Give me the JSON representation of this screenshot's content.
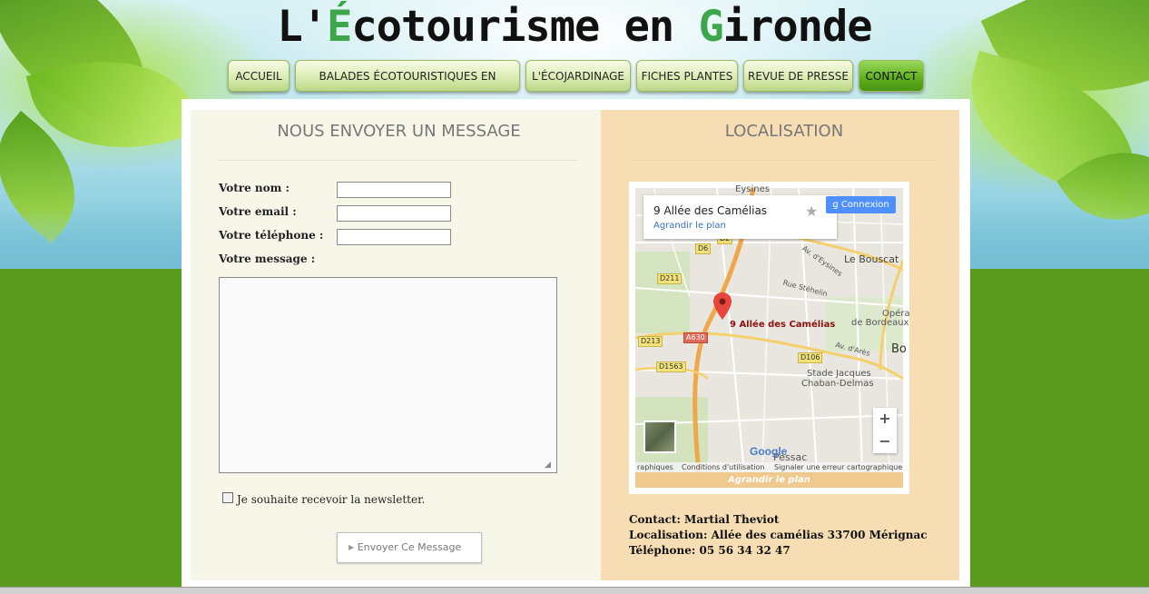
{
  "site": {
    "title_part1": "L'",
    "title_e": "É",
    "title_part2": "cotourisme en ",
    "title_g": "G",
    "title_part3": "ironde"
  },
  "nav": {
    "items": [
      {
        "label": "ACCUEIL"
      },
      {
        "label": "BALADES ÉCOTOURISTIQUES EN GIRONDE"
      },
      {
        "label": "L'ÉCOJARDINAGE"
      },
      {
        "label": "FICHES PLANTES"
      },
      {
        "label": "REVUE DE PRESSE"
      },
      {
        "label": "CONTACT"
      }
    ],
    "active_index": 5
  },
  "form": {
    "title": "NOUS ENVOYER UN MESSAGE",
    "name_label": "Votre nom :",
    "email_label": "Votre email :",
    "phone_label": "Votre téléphone :",
    "message_label": "Votre message :",
    "name_value": "",
    "email_value": "",
    "phone_value": "",
    "message_value": "",
    "newsletter_label": "Je souhaite recevoir la newsletter.",
    "newsletter_checked": false,
    "submit_label": "Envoyer Ce Message"
  },
  "location": {
    "title": "LOCALISATION",
    "map": {
      "place_name": "9 Allée des Camélias",
      "enlarge_link": "Agrandir le plan",
      "connexion_label": "Connexion",
      "marker_label": "9 Allée des Camélias",
      "zoom_in": "+",
      "zoom_out": "−",
      "google_logo": "Google",
      "footer_data": "raphiques",
      "footer_terms": "Conditions d'utilisation",
      "footer_report": "Signaler une erreur cartographique",
      "bottom_link": "Agrandir le plan",
      "labels": {
        "eysines": "Eysines",
        "le_bouscat": "Le Bouscat",
        "rue_stehelin": "Rue Stéhelin",
        "av_eysines": "Av. d'Eysines",
        "opera": "Opéra",
        "de_bordeaux": "de Bordeaux",
        "bo": "Bo",
        "av_ares": "Av. d'Arès",
        "stade_1": "Stade Jacques",
        "stade_2": "Chaban-Delmas",
        "pessac": "Pessac",
        "d6": "D6",
        "d211": "D211",
        "d213": "D213",
        "a630": "A630",
        "d106": "D106",
        "d1563": "D1563",
        "d2": "D2"
      }
    },
    "contact_line": "Contact: Martial Theviot",
    "address_line": "Localisation: Allée des camélias 33700 Mérignac",
    "phone_line": "Téléphone: 05 56 34 32 47"
  }
}
